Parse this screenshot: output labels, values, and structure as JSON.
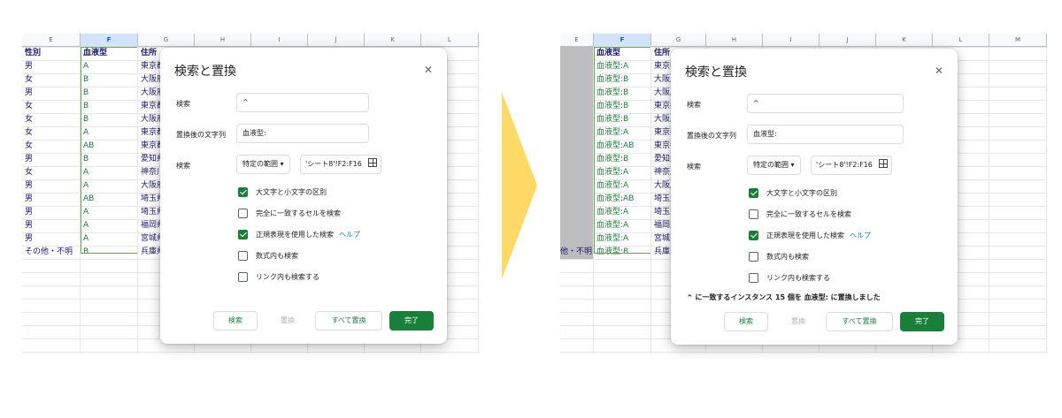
{
  "columns_left": [
    "E",
    "F",
    "G",
    "H",
    "I",
    "J",
    "K",
    "L"
  ],
  "columns_right": [
    "E",
    "F",
    "G",
    "H",
    "I",
    "J",
    "K",
    "L",
    "M"
  ],
  "selected_column": "F",
  "left_sheet": {
    "headers": [
      "性別",
      "血液型",
      "住所"
    ],
    "rows": [
      [
        "男",
        "A",
        "東京都"
      ],
      [
        "女",
        "B",
        "大阪府"
      ],
      [
        "男",
        "B",
        "大阪府"
      ],
      [
        "女",
        "B",
        "東京都"
      ],
      [
        "女",
        "B",
        "大阪府"
      ],
      [
        "女",
        "A",
        "東京都"
      ],
      [
        "女",
        "AB",
        "東京都"
      ],
      [
        "男",
        "B",
        "愛知県"
      ],
      [
        "女",
        "A",
        "神奈川"
      ],
      [
        "男",
        "A",
        "大阪府"
      ],
      [
        "男",
        "AB",
        "埼玉県"
      ],
      [
        "男",
        "A",
        "埼玉県"
      ],
      [
        "男",
        "A",
        "福岡県"
      ],
      [
        "男",
        "A",
        "宮城県"
      ],
      [
        "その他・不明",
        "B",
        "兵庫県"
      ]
    ],
    "row_prefixes": [
      "三",
      "三",
      "0",
      "三",
      "三",
      "三",
      "三",
      "6",
      "0",
      "三",
      "1",
      "",
      "",
      "1",
      ""
    ]
  },
  "right_sheet": {
    "headers": [
      "",
      "血液型",
      "住所"
    ],
    "rows": [
      [
        "",
        "血液型:A",
        "東京都"
      ],
      [
        "",
        "血液型:B",
        "大阪府"
      ],
      [
        "",
        "血液型:B",
        "大阪府"
      ],
      [
        "",
        "血液型:B",
        "東京都"
      ],
      [
        "",
        "血液型:B",
        "大阪府"
      ],
      [
        "",
        "血液型:A",
        "東京都"
      ],
      [
        "",
        "血液型:AB",
        "東京都"
      ],
      [
        "",
        "血液型:B",
        "愛知県"
      ],
      [
        "",
        "血液型:A",
        "神奈川"
      ],
      [
        "",
        "血液型:A",
        "大阪府"
      ],
      [
        "",
        "血液型:AB",
        "埼玉県"
      ],
      [
        "",
        "血液型:A",
        "埼玉県"
      ],
      [
        "",
        "血液型:A",
        "福岡県"
      ],
      [
        "",
        "血液型:A",
        "宮城県"
      ],
      [
        "他・不明",
        "血液型:B",
        "兵庫県"
      ]
    ]
  },
  "dialog": {
    "title": "検索と置換",
    "close_icon": "close-icon",
    "search_label": "検索",
    "search_value": "^",
    "replace_label": "置換後の文字列",
    "replace_value": "血液型:",
    "scope_label": "検索",
    "scope_value": "特定の範囲",
    "range_value": "'シート8'!F2:F16",
    "options": [
      {
        "label": "大文字と小文字の区別",
        "checked": true
      },
      {
        "label": "完全に一致するセルを検索",
        "checked": false
      },
      {
        "label": "正規表現を使用した検索",
        "checked": true,
        "help": "ヘルプ"
      },
      {
        "label": "数式内も検索",
        "checked": false
      },
      {
        "label": "リンク内も検索する",
        "checked": false
      }
    ],
    "status_message": "^ に一致するインスタンス 15 個を 血液型: に置換しました",
    "buttons": {
      "find": "検索",
      "replace": "置換",
      "replace_all": "すべて置換",
      "done": "完了"
    }
  },
  "colors": {
    "accent": "#188038",
    "arrow": "#ffd966",
    "selection": "#6aa84f",
    "header_selected": "#d3e3fd"
  }
}
